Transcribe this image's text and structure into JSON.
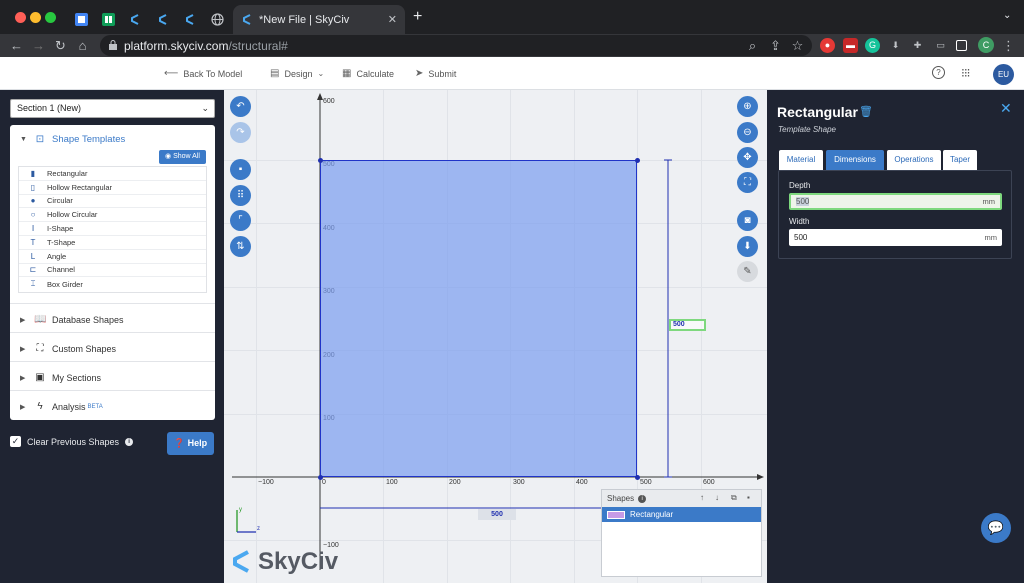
{
  "browser": {
    "tab_title": "*New File | SkyCiv",
    "url_domain": "platform.skyciv.com",
    "url_path": "/structural#",
    "profile_initial": "C"
  },
  "appbar": {
    "back_label": "Back To Model",
    "design_label": "Design",
    "calculate_label": "Calculate",
    "submit_label": "Submit",
    "user_initials": "EU"
  },
  "left": {
    "section_select": "Section 1 (New)",
    "shape_templates": "Shape Templates",
    "show_all": "Show All",
    "templates": [
      {
        "label": "Rectangular",
        "icon": "rect-filled-icon"
      },
      {
        "label": "Hollow Rectangular",
        "icon": "rect-hollow-icon"
      },
      {
        "label": "Circular",
        "icon": "circle-filled-icon"
      },
      {
        "label": "Hollow Circular",
        "icon": "circle-hollow-icon"
      },
      {
        "label": "I-Shape",
        "icon": "i-shape-icon"
      },
      {
        "label": "T-Shape",
        "icon": "t-shape-icon"
      },
      {
        "label": "Angle",
        "icon": "angle-icon"
      },
      {
        "label": "Channel",
        "icon": "channel-icon"
      },
      {
        "label": "Box Girder",
        "icon": "box-girder-icon"
      }
    ],
    "database_shapes": "Database Shapes",
    "custom_shapes": "Custom Shapes",
    "my_sections": "My Sections",
    "analysis": "Analysis",
    "analysis_badge": "BETA",
    "clear_previous": "Clear Previous Shapes",
    "help": "Help"
  },
  "canvas": {
    "y_ticks": [
      "600",
      "500",
      "400",
      "300",
      "200",
      "100"
    ],
    "y_tick_neg": "−100",
    "x_ticks": [
      "−100",
      "0",
      "100",
      "200",
      "300",
      "400",
      "500",
      "600"
    ],
    "depth_dim": "500",
    "width_dim": "500",
    "axis_y": "y",
    "axis_z": "z",
    "logo_text": "SkyCiv"
  },
  "shapes_panel": {
    "title": "Shapes",
    "items": [
      "Rectangular"
    ]
  },
  "right": {
    "title": "Rectangular",
    "subtitle": "Template Shape",
    "tabs": [
      "Material",
      "Dimensions",
      "Operations",
      "Taper"
    ],
    "active_tab": "Dimensions",
    "depth_label": "Depth",
    "depth_value": "500",
    "width_label": "Width",
    "width_value": "500",
    "unit": "mm"
  },
  "colors": {
    "accent": "#3b7ac8",
    "panel_bg": "#1f2432",
    "shape_fill": "#7a9cf0",
    "shape_stroke": "#2034c8"
  }
}
